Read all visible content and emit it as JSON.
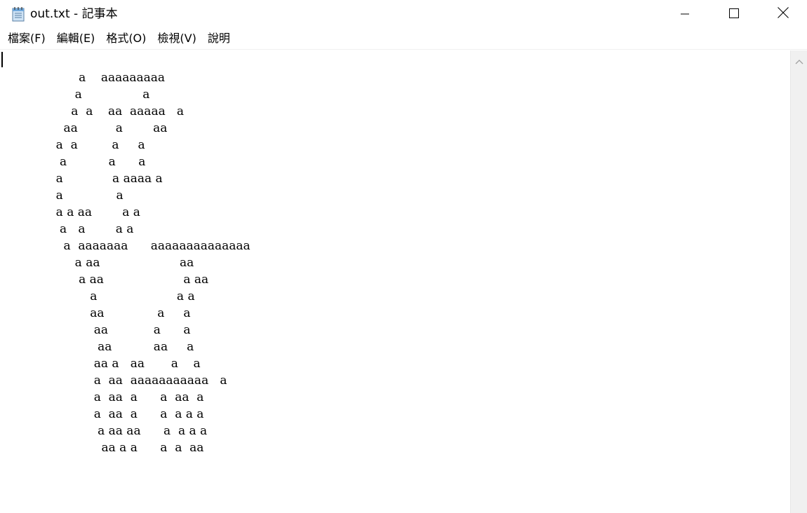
{
  "window": {
    "title": "out.txt - 記事本",
    "app_icon": "notepad-icon",
    "controls": {
      "minimize_icon": "minimize-icon",
      "maximize_icon": "maximize-icon",
      "close_icon": "close-icon"
    }
  },
  "menubar": {
    "items": [
      {
        "label": "檔案(F)"
      },
      {
        "label": "編輯(E)"
      },
      {
        "label": "格式(O)"
      },
      {
        "label": "檢視(V)"
      },
      {
        "label": "說明"
      }
    ]
  },
  "editor": {
    "lines": [
      "                    a    aaaaaaaaa",
      "                   a                a",
      "                  a  a    aa  aaaaa   a",
      "                aa          a        aa",
      "              a  a         a     a",
      "               a           a      a",
      "              a             a aaaa a",
      "              a              a",
      "              a a aa        a a",
      "               a   a        a a",
      "                a  aaaaaaa      aaaaaaaaaaaaaa",
      "                   a aa                     aa",
      "                    a aa                     a aa",
      "                       a                     a a",
      "                       aa              a     a",
      "                        aa            a      a",
      "                         aa           aa     a",
      "                        aa a   aa       a    a",
      "                        a  aa  aaaaaaaaaaa   a",
      "                        a  aa  a      a  aa  a",
      "                        a  aa  a      a  a a a",
      "                         a aa aa      a  a a a",
      "                          aa a a      a  a  aa"
    ]
  },
  "scrollbar": {
    "up_icon": "chevron-up-icon"
  }
}
